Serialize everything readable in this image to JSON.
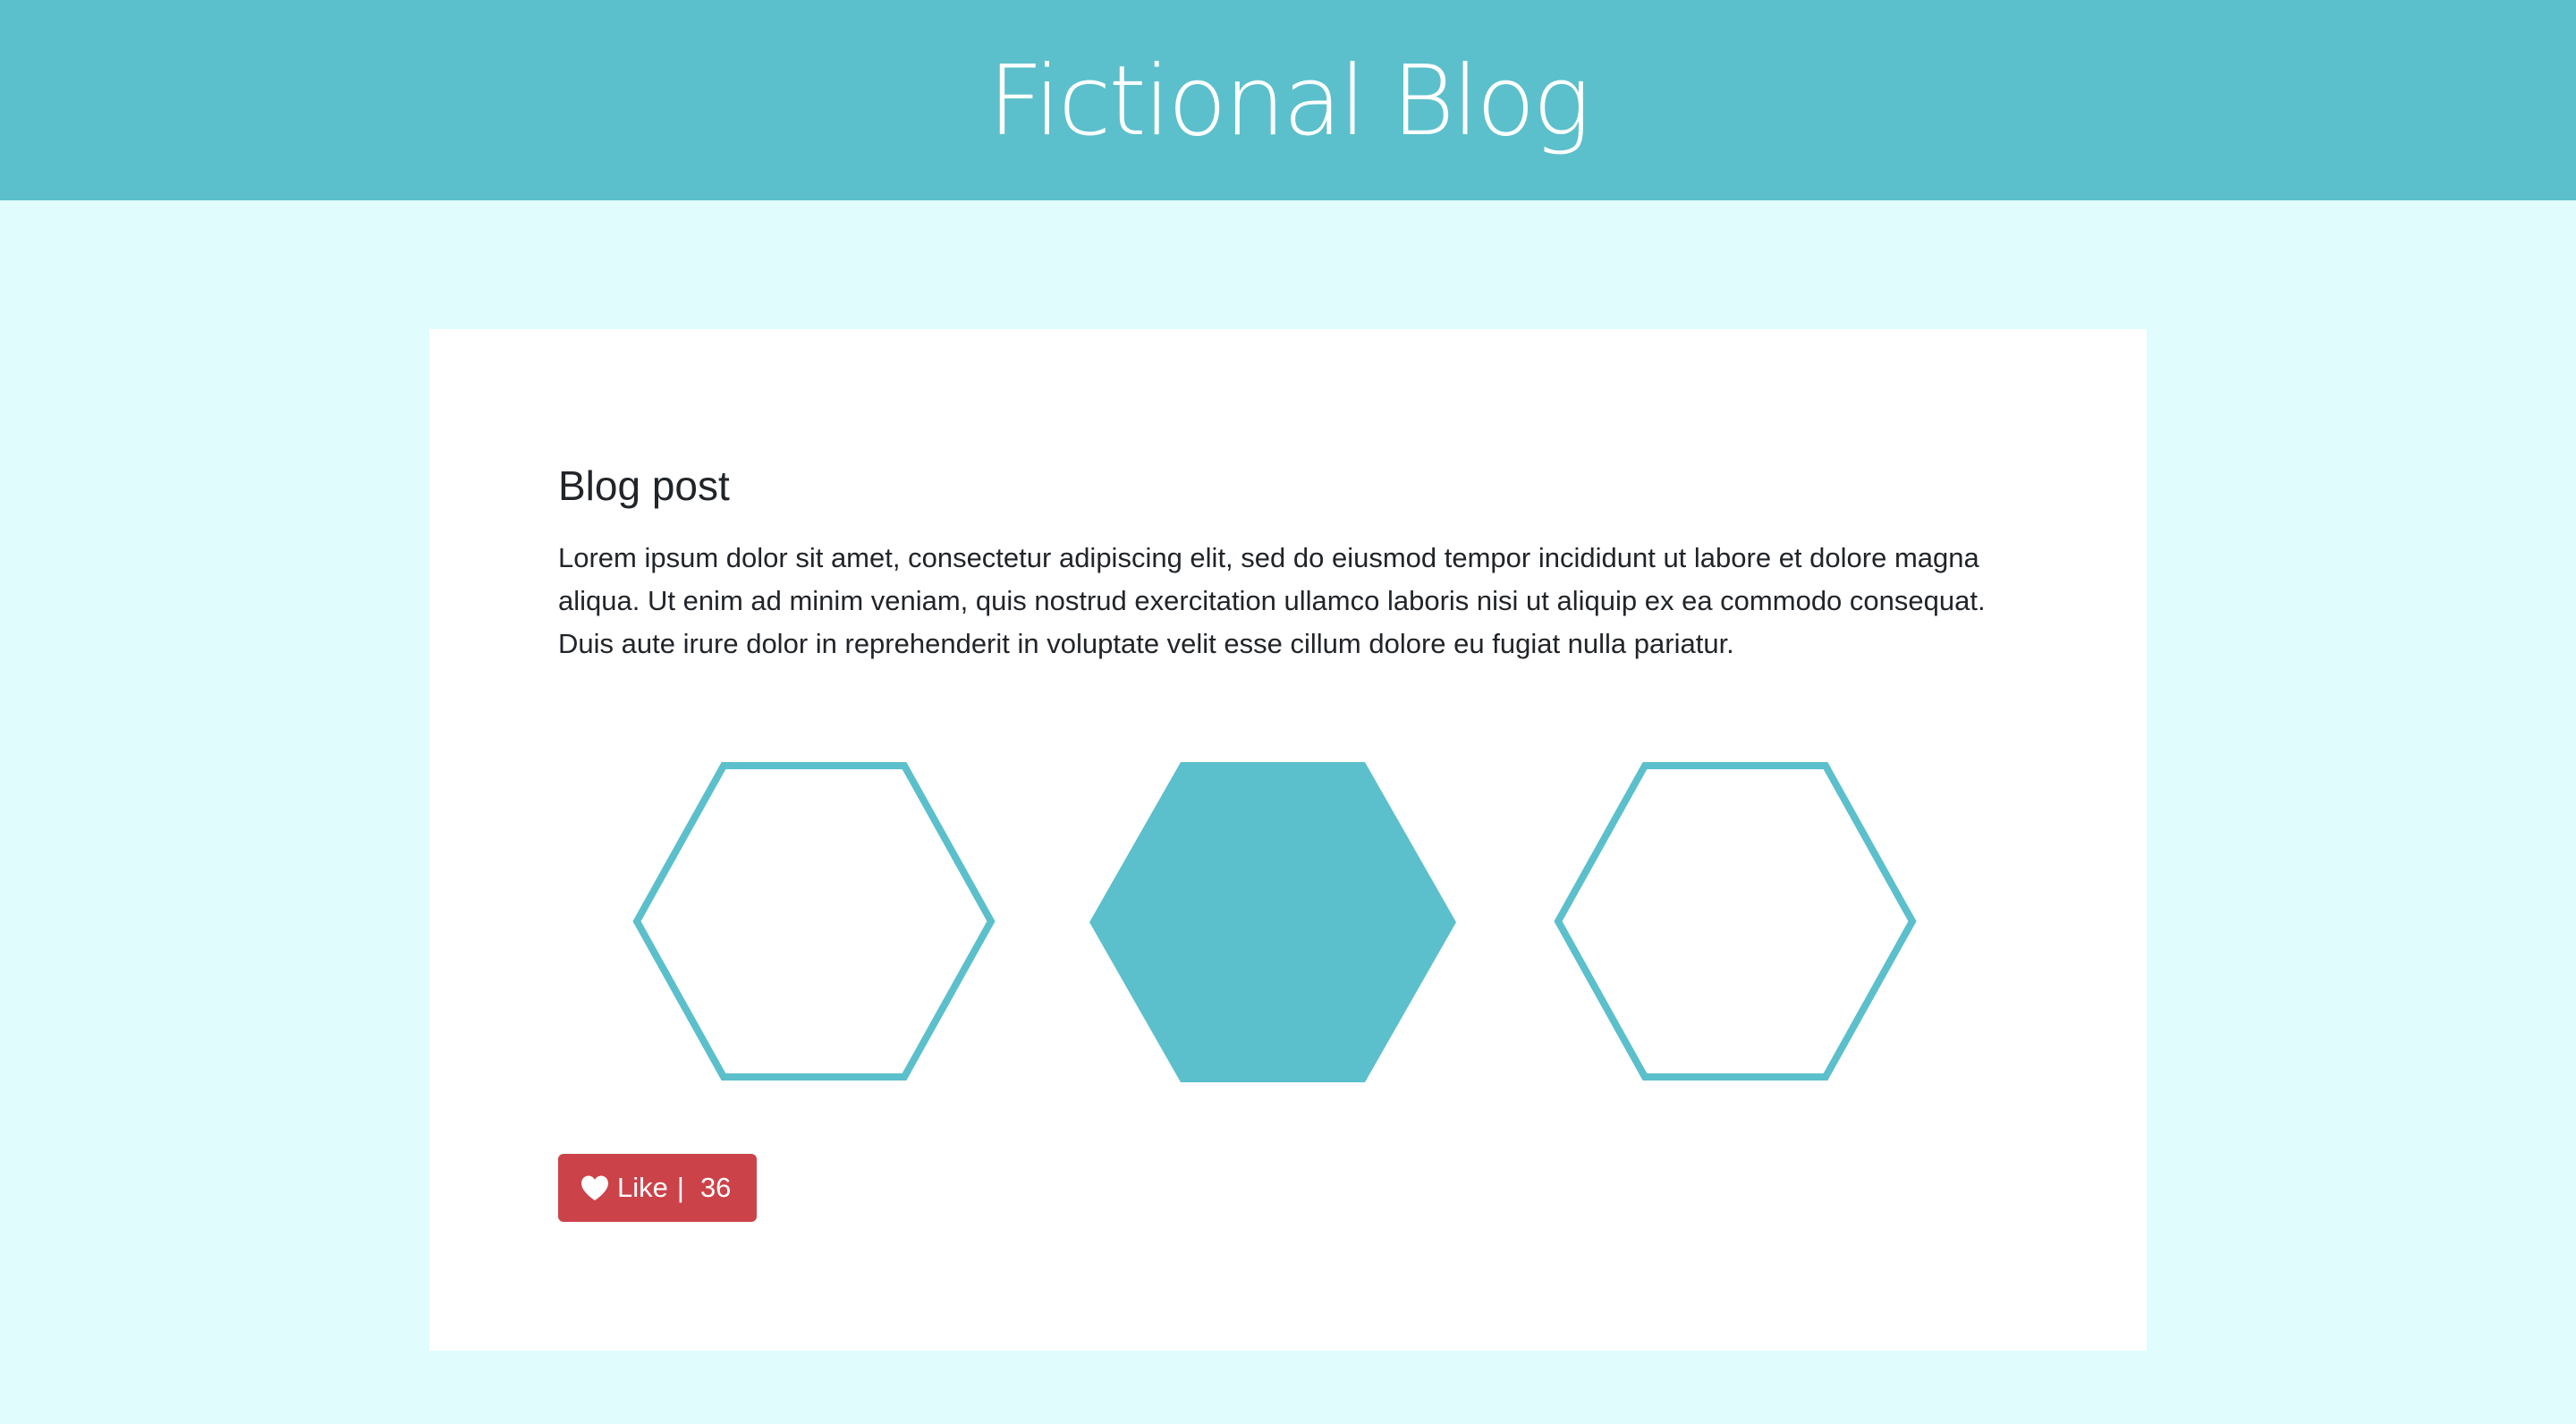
{
  "header": {
    "title": "Fictional Blog",
    "background": "#5bc0cb"
  },
  "post": {
    "title": "Blog post",
    "body": "Lorem ipsum dolor sit amet, consectetur adipiscing elit, sed do eiusmod tempor incididunt ut labore et dolore magna aliqua. Ut enim ad minim veniam, quis nostrud exercitation ullamco laboris nisi ut aliquip ex ea commodo consequat. Duis aute irure dolor in reprehenderit in voluptate velit esse cillum dolore eu fugiat nulla pariatur."
  },
  "hexagons": [
    {
      "style": "outline"
    },
    {
      "style": "filled"
    },
    {
      "style": "outline"
    }
  ],
  "like_button": {
    "icon": "heart-icon",
    "label": "Like",
    "separator": "|",
    "count": "36",
    "color": "#cc4249"
  },
  "colors": {
    "page_background": "#e1fcfd",
    "accent": "#5bc0cb",
    "card": "#ffffff"
  }
}
